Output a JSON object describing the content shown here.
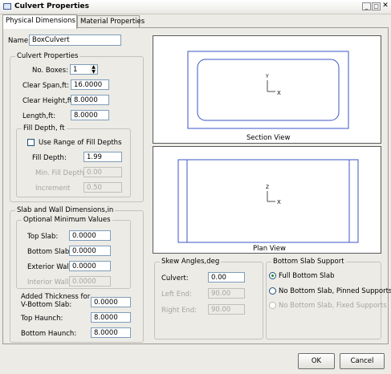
{
  "window": {
    "title": "Culvert Properties"
  },
  "tabs": [
    "Physical Dimensions",
    "Material Properties"
  ],
  "name": {
    "label": "Name:",
    "value": "BoxCulvert"
  },
  "culvert_properties": {
    "title": "Culvert Properties",
    "no_boxes": {
      "label": "No. Boxes:",
      "value": "1"
    },
    "clear_span": {
      "label": "Clear Span,ft:",
      "value": "16.0000"
    },
    "clear_height": {
      "label": "Clear Height,ft:",
      "value": "8.0000"
    },
    "length": {
      "label": "Length,ft:",
      "value": "8.0000"
    },
    "fill_depth": {
      "title": "Fill Depth, ft",
      "use_range_label": "Use Range of Fill Depths",
      "fill_depth_label": "Fill Depth:",
      "fill_depth_value": "1.99",
      "min_label": "Min. Fill Depth",
      "min_value": "0.00",
      "increment_label": "Increment",
      "increment_value": "0.50"
    }
  },
  "slab_wall": {
    "title": "Slab and Wall Dimensions,in",
    "optional_title": "Optional Minimum Values",
    "top_slab": {
      "label": "Top Slab:",
      "value": "0.0000"
    },
    "bottom_slab": {
      "label": "Bottom Slab:",
      "value": "0.0000"
    },
    "exterior_wall": {
      "label": "Exterior Wall:",
      "value": "0.0000"
    },
    "interior_wall": {
      "label": "Interior Wall:",
      "value": "0.0000"
    },
    "added_thickness": {
      "label_line1": "Added Thickness for",
      "label_line2": "V-Bottom Slab:",
      "value": "0.0000"
    },
    "top_haunch": {
      "label": "Top Haunch:",
      "value": "8.0000"
    },
    "bottom_haunch": {
      "label": "Bottom Haunch:",
      "value": "8.0000"
    }
  },
  "section_view": {
    "caption": "Section View",
    "axis_y": "Y",
    "axis_x": "X"
  },
  "plan_view": {
    "caption": "Plan View",
    "axis_y": "Z",
    "axis_x": "X"
  },
  "skew": {
    "title": "Skew Angles,deg",
    "culvert": {
      "label": "Culvert:",
      "value": "0.00"
    },
    "left_end": {
      "label": "Left End:",
      "value": "90.00"
    },
    "right_end": {
      "label": "Right End:",
      "value": "90.00"
    }
  },
  "bottom_support": {
    "title": "Bottom Slab Support",
    "options": [
      "Full Bottom Slab",
      "No Bottom Slab, Pinned Supports",
      "No Bottom Slab, Fixed Supports"
    ],
    "selected": "Full Bottom Slab"
  },
  "buttons": {
    "ok": "OK",
    "cancel": "Cancel"
  },
  "colors": {
    "drawing_line": "#3b56c4",
    "input_border": "#7f9db9",
    "selected_radio": "#1a8a1a"
  }
}
